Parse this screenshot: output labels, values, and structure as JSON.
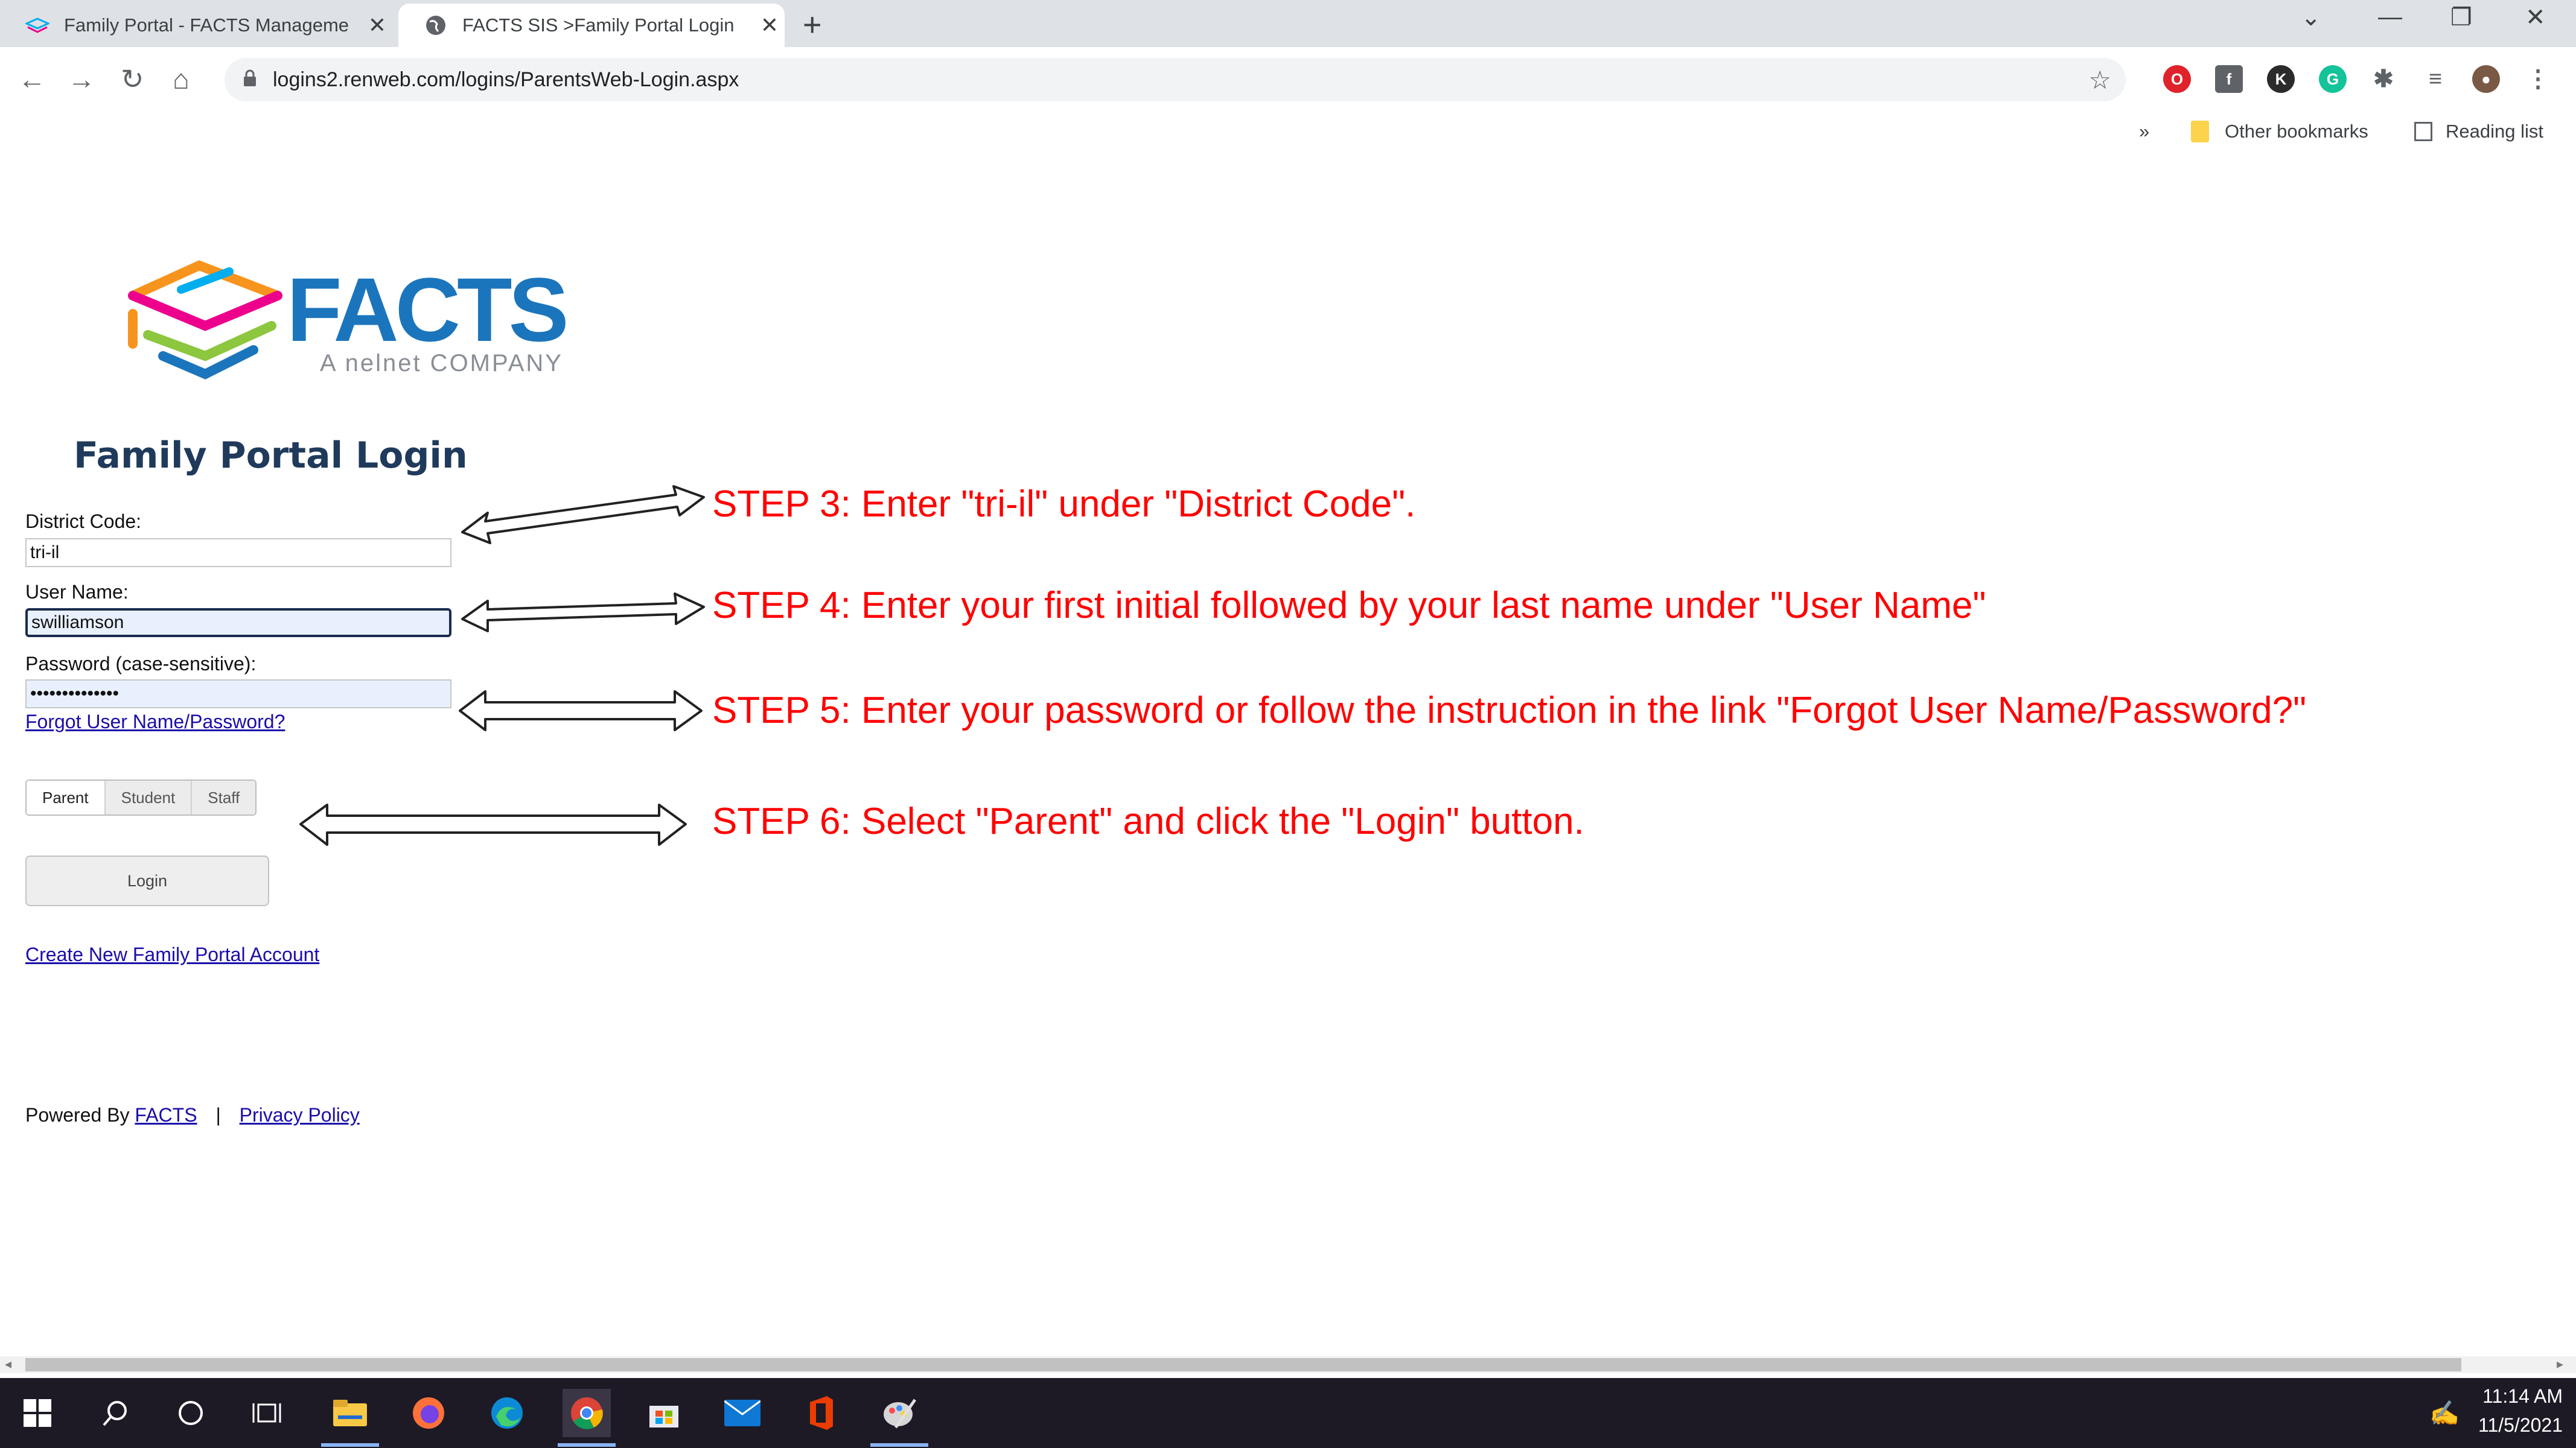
{
  "browser": {
    "tabs": [
      {
        "title": "Family Portal - FACTS Manageme",
        "active": false
      },
      {
        "title": "FACTS SIS >Family Portal Login",
        "active": true
      }
    ],
    "new_tab_icon": "plus-icon",
    "window_controls": [
      "chevron-down-icon",
      "minimize-icon",
      "restore-icon",
      "close-icon"
    ],
    "url": "logins2.renweb.com/logins/ParentsWeb-Login.aspx",
    "bookmarks": {
      "overflow": "»",
      "other": "Other bookmarks",
      "reading_list": "Reading list"
    }
  },
  "logo": {
    "brand": "FACTS",
    "tagline": "A nelnet COMPANY",
    "colors": [
      "#f7941d",
      "#ec008c",
      "#8dc63f",
      "#00aeef",
      "#1b75bc"
    ]
  },
  "login": {
    "title": "Family Portal Login",
    "district_label": "District Code:",
    "district_value": "tri-il",
    "username_label": "User Name:",
    "username_value": "swilliamson",
    "password_label": "Password (case-sensitive):",
    "password_value": "••••••••••••••",
    "forgot_link": "Forgot User Name/Password?",
    "roles": [
      "Parent",
      "Student",
      "Staff"
    ],
    "selected_role": "Parent",
    "login_button": "Login",
    "create_account_link": "Create New Family Portal Account"
  },
  "steps": {
    "step3": "STEP 3: Enter \"tri-il\" under \"District Code\".",
    "step4": "STEP 4: Enter your first initial followed by your last name under \"User Name\"",
    "step5": "STEP 5: Enter your password or follow the instruction in the link \"Forgot User Name/Password?\"",
    "step6": "STEP 6: Select \"Parent\" and click the \"Login\" button."
  },
  "footer": {
    "powered_by": "Powered By",
    "facts_link": "FACTS",
    "separator": "|",
    "privacy_link": "Privacy Policy"
  },
  "taskbar": {
    "apps": [
      "windows-start-icon",
      "search-icon",
      "cortana-icon",
      "task-view-icon",
      "file-explorer-icon",
      "firefox-icon",
      "edge-icon",
      "chrome-icon",
      "store-icon",
      "mail-icon",
      "office-icon",
      "paint-icon"
    ],
    "time": "11:14 AM",
    "date": "11/5/2021"
  },
  "colors": {
    "accent_red": "#ff0000",
    "link": "#1a0dab",
    "title_navy": "#1f3a5b",
    "taskbar": "#1d1a26"
  }
}
